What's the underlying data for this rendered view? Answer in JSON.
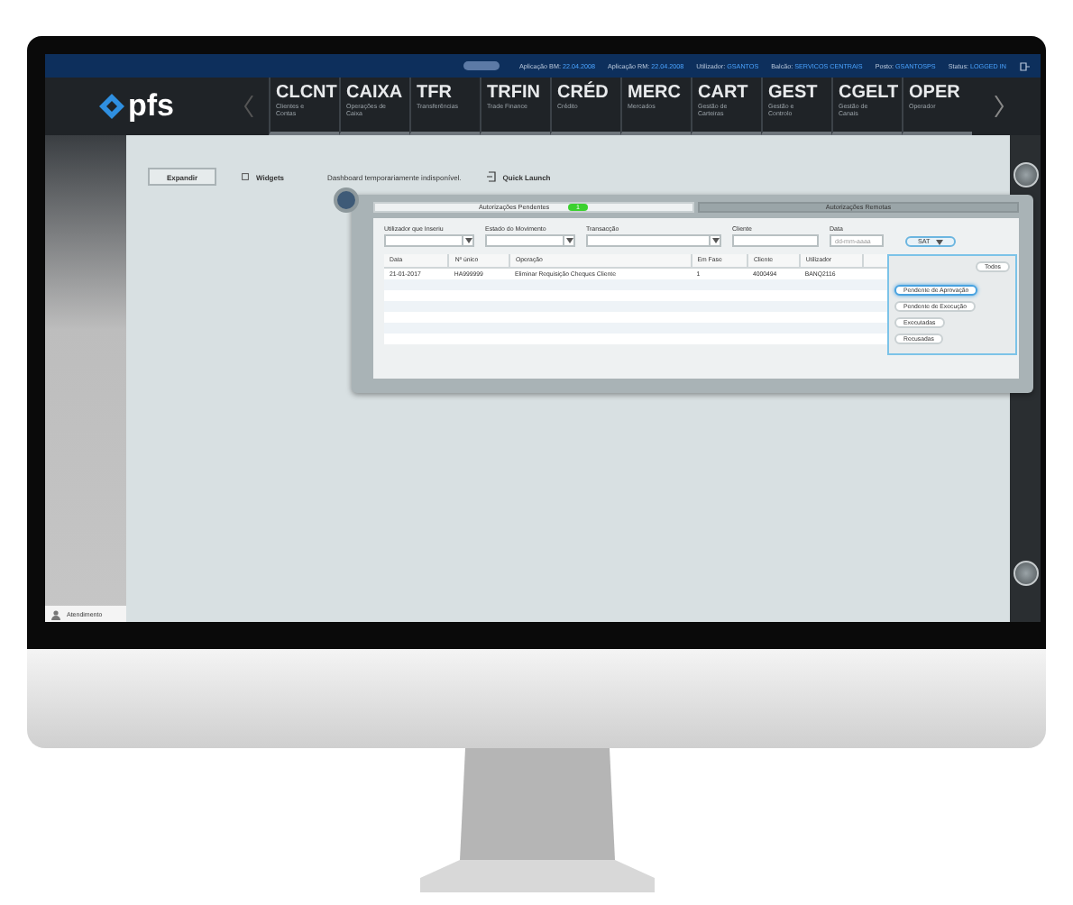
{
  "status_bar": {
    "items": [
      {
        "label": "Aplicação BM:",
        "value": "22.04.2008"
      },
      {
        "label": "Aplicação RM:",
        "value": "22.04.2008"
      },
      {
        "label": "Utilizador:",
        "value": "GSANTOS"
      },
      {
        "label": "Balcão:",
        "value": "SERVICOS CENTRAIS"
      },
      {
        "label": "Posto:",
        "value": "GSANTOSPS"
      },
      {
        "label": "Status:",
        "value": "LOGGED IN"
      }
    ]
  },
  "nav": {
    "logo": "pfs",
    "modules": [
      {
        "code": "CLCNT",
        "name": "Clientes e Contas"
      },
      {
        "code": "CAIXA",
        "name": "Operações de Caixa"
      },
      {
        "code": "TFR",
        "name": "Transferências"
      },
      {
        "code": "TRFIN",
        "name": "Trade Finance"
      },
      {
        "code": "CRÉD",
        "name": "Crédito"
      },
      {
        "code": "MERC",
        "name": "Mercados"
      },
      {
        "code": "CART",
        "name": "Gestão de Carteiras"
      },
      {
        "code": "GEST",
        "name": "Gestão e Controlo"
      },
      {
        "code": "CGELT",
        "name": "Gestão de Canais"
      },
      {
        "code": "OPER",
        "name": "Operador"
      }
    ]
  },
  "toolbar": {
    "expand_button": "Expandir",
    "widgets": "Widgets",
    "dashboard_message": "Dashboard temporariamente indisponível.",
    "quick_launch": "Quick Launch"
  },
  "panel": {
    "tabs": [
      {
        "label": "Autorizações Pendentes",
        "selected": true,
        "badge": "1"
      },
      {
        "label": "Autorizações Remotas",
        "selected": false
      }
    ],
    "filters": [
      {
        "label": "Utilizador que Inseriu",
        "kind": "select"
      },
      {
        "label": "Estado do Movimento",
        "kind": "select"
      },
      {
        "label": "Transacção",
        "kind": "select"
      },
      {
        "label": "Cliente",
        "kind": "text"
      },
      {
        "label": "Data",
        "kind": "date",
        "placeholder": "dd-mm-aaaa"
      }
    ],
    "status_button": "SAT",
    "table": {
      "columns": [
        "Data",
        "Nº único",
        "Operação",
        "Em Fase",
        "Cliente",
        "Utilizador"
      ],
      "rows": [
        [
          "21-01-2017",
          "HA999999",
          "Eliminar Requisição Cheques Cliente",
          "1",
          "4000494",
          "BANQ2116"
        ]
      ]
    },
    "dropdown": {
      "options": [
        {
          "label": "Todos",
          "selected": false
        },
        {
          "label": "Pendente de Aprovação",
          "selected": true
        },
        {
          "label": "Pendente de Execução",
          "selected": false
        },
        {
          "label": "Executadas",
          "selected": false
        },
        {
          "label": "Recusadas",
          "selected": false
        }
      ]
    }
  },
  "sidebar": {
    "footer": "Atendimento"
  }
}
